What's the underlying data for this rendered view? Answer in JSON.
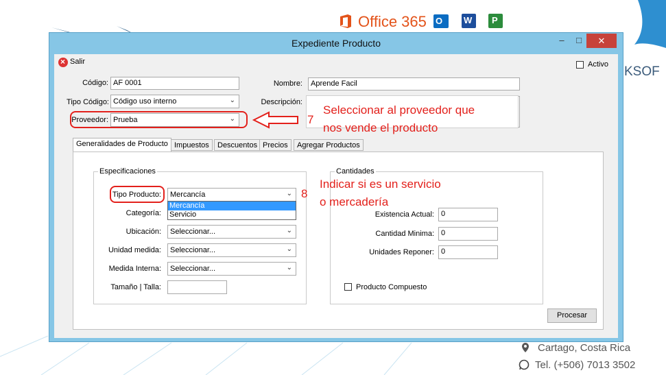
{
  "background": {
    "office_label": "Office 365",
    "brand_fragment": "KSOF",
    "contact_location": "Cartago, Costa Rica",
    "contact_phone": "Tel. (+506) 7013 3502"
  },
  "window": {
    "title": "Expediente Producto",
    "minimize": "–",
    "maximize": "□",
    "close": "✕"
  },
  "toolbar": {
    "exit_label": "Salir"
  },
  "form": {
    "codigo_label": "Código:",
    "codigo_value": "AF 0001",
    "nombre_label": "Nombre:",
    "nombre_value": "Aprende Facil",
    "tipo_codigo_label": "Tipo Código:",
    "tipo_codigo_value": "Código uso interno",
    "descripcion_label": "Descripción:",
    "proveedor_label": "Proveedor:",
    "proveedor_value": "Prueba",
    "activo_label": "Activo"
  },
  "tabs": [
    "Generalidades de Producto",
    "Impuestos",
    "Descuentos",
    "Precios",
    "Agregar Productos"
  ],
  "especificaciones": {
    "title": "Especificaciones",
    "tipo_producto_label": "Tipo Producto:",
    "tipo_producto_value": "Mercancía",
    "dropdown_options": [
      "Mercancía",
      "Servicio"
    ],
    "categoria_label": "Categoría:",
    "ubicacion_label": "Ubicación:",
    "ubicacion_value": "Seleccionar...",
    "unidad_medida_label": "Unidad medida:",
    "unidad_medida_value": "Seleccionar...",
    "medida_interna_label": "Medida Interna:",
    "medida_interna_value": "Seleccionar...",
    "talla_label": "Tamaño | Talla:"
  },
  "cantidades": {
    "title": "Cantidades",
    "existencia_label": "Existencia Actual:",
    "existencia_value": "0",
    "minima_label": "Cantidad Minima:",
    "minima_value": "0",
    "reponer_label": "Unidades Reponer:",
    "reponer_value": "0",
    "compuesto_label": "Producto Compuesto"
  },
  "procesar_label": "Procesar",
  "annotations": {
    "step7_number": "7",
    "step7_line1": "Seleccionar al proveedor que",
    "step7_line2": "nos vende el producto",
    "step8_number": "8",
    "step8_line1": "Indicar si es un servicio",
    "step8_line2": "o mercadería"
  },
  "colors": {
    "window_frame": "#86c6e6",
    "close_button": "#c7423a",
    "annotation_red": "#e3201b",
    "office_orange": "#e3531a",
    "dropdown_highlight": "#3399ff"
  }
}
